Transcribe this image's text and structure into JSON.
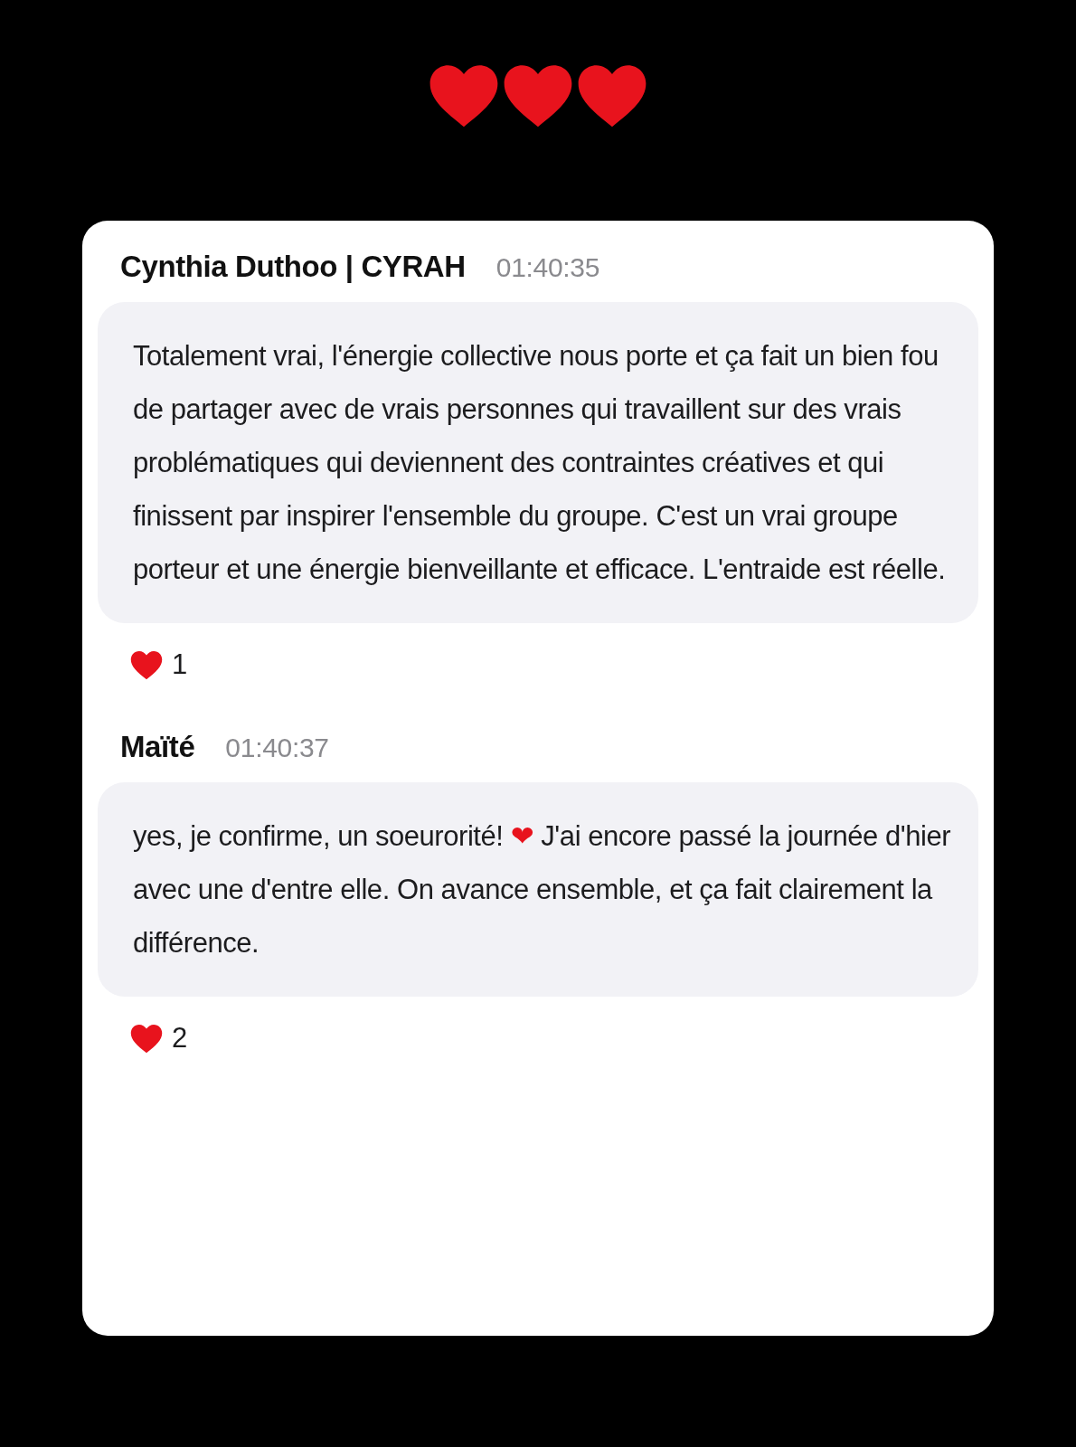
{
  "header_hearts": [
    {
      "kind": "heart"
    },
    {
      "kind": "heart"
    },
    {
      "kind": "heart"
    }
  ],
  "messages": [
    {
      "author": "Cynthia Duthoo | CYRAH",
      "time": "01:40:35",
      "segments": [
        {
          "kind": "text",
          "text": "Totalement vrai, l'énergie collective nous porte et ça fait un bien fou de partager avec de vrais personnes qui travaillent sur des vrais problématiques qui deviennent des contraintes créatives et qui finissent par inspirer l'ensemble du groupe. C'est un vrai groupe porteur et une énergie bienveillante et efficace. L'entraide est réelle."
        }
      ],
      "reaction": {
        "kind": "heart",
        "count": "1"
      }
    },
    {
      "author": "Maïté",
      "time": "01:40:37",
      "segments": [
        {
          "kind": "text",
          "text": "yes, je confirme, un soeurorité! "
        },
        {
          "kind": "emoji",
          "text": "❤"
        },
        {
          "kind": "text",
          "text": " J'ai encore passé la journée d'hier avec une d'entre elle. On avance ensemble, et ça fait clairement la différence."
        }
      ],
      "reaction": {
        "kind": "heart",
        "count": "2"
      }
    }
  ]
}
